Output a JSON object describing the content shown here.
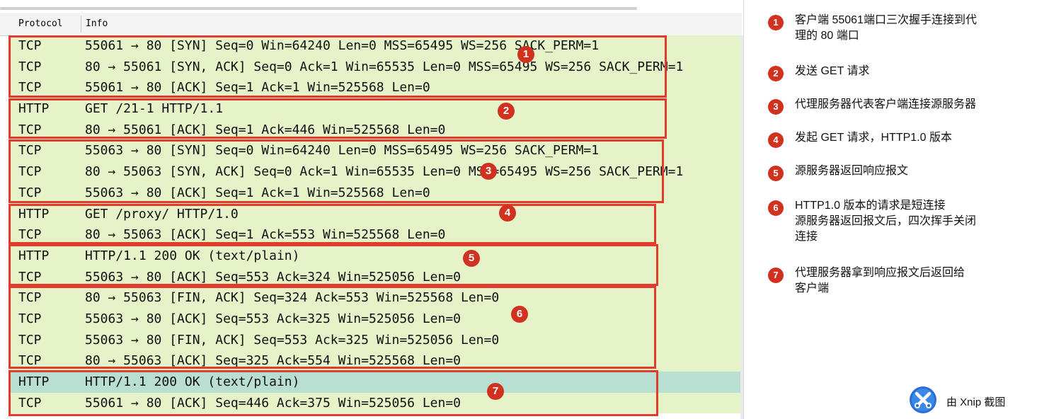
{
  "header": {
    "protocol": "Protocol",
    "info": "Info"
  },
  "rows": [
    {
      "protocol": "TCP",
      "info": "55061 → 80 [SYN] Seq=0 Win=64240 Len=0 MSS=65495 WS=256 SACK_PERM=1"
    },
    {
      "protocol": "TCP",
      "info": "80 → 55061 [SYN, ACK] Seq=0 Ack=1 Win=65535 Len=0 MSS=65495 WS=256 SACK_PERM=1"
    },
    {
      "protocol": "TCP",
      "info": "55061 → 80 [ACK] Seq=1 Ack=1 Win=525568 Len=0"
    },
    {
      "protocol": "HTTP",
      "info": "GET /21-1 HTTP/1.1"
    },
    {
      "protocol": "TCP",
      "info": "80 → 55061 [ACK] Seq=1 Ack=446 Win=525568 Len=0"
    },
    {
      "protocol": "TCP",
      "info": "55063 → 80 [SYN] Seq=0 Win=64240 Len=0 MSS=65495 WS=256 SACK_PERM=1"
    },
    {
      "protocol": "TCP",
      "info": "80 → 55063 [SYN, ACK] Seq=0 Ack=1 Win=65535 Len=0 MSS=65495 WS=256 SACK_PERM=1"
    },
    {
      "protocol": "TCP",
      "info": "55063 → 80 [ACK] Seq=1 Ack=1 Win=525568 Len=0"
    },
    {
      "protocol": "HTTP",
      "info": "GET /proxy/ HTTP/1.0"
    },
    {
      "protocol": "TCP",
      "info": "80 → 55063 [ACK] Seq=1 Ack=553 Win=525568 Len=0"
    },
    {
      "protocol": "HTTP",
      "info": "HTTP/1.1 200 OK  (text/plain)"
    },
    {
      "protocol": "TCP",
      "info": "55063 → 80 [ACK] Seq=553 Ack=324 Win=525056 Len=0"
    },
    {
      "protocol": "TCP",
      "info": "80 → 55063 [FIN, ACK] Seq=324 Ack=553 Win=525568 Len=0"
    },
    {
      "protocol": "TCP",
      "info": "55063 → 80 [ACK] Seq=553 Ack=325 Win=525056 Len=0"
    },
    {
      "protocol": "TCP",
      "info": "55063 → 80 [FIN, ACK] Seq=553 Ack=325 Win=525056 Len=0"
    },
    {
      "protocol": "TCP",
      "info": "80 → 55063 [ACK] Seq=325 Ack=554 Win=525568 Len=0"
    },
    {
      "protocol": "HTTP",
      "info": "HTTP/1.1 200 OK  (text/plain)"
    },
    {
      "protocol": "TCP",
      "info": "55061 → 80 [ACK] Seq=446 Ack=375 Win=525056 Len=0"
    }
  ],
  "groups": [
    "1",
    "2",
    "3",
    "4",
    "5",
    "6",
    "7"
  ],
  "notes": [
    {
      "num": "1",
      "text": "客户端 55061端口三次握手连接到代\n理的 80 端口"
    },
    {
      "num": "2",
      "text": "发送 GET 请求"
    },
    {
      "num": "3",
      "text": "代理服务器代表客户端连接源服务器"
    },
    {
      "num": "4",
      "text": "发起 GET 请求，HTTP1.0 版本"
    },
    {
      "num": "5",
      "text": "源服务器返回响应报文"
    },
    {
      "num": "6",
      "text": "HTTP1.0 版本的请求是短连接\n源服务器返回报文后，四次挥手关闭\n连接"
    },
    {
      "num": "7",
      "text": "代理服务器拿到响应报文后返回给\n客户端"
    }
  ],
  "watermark": {
    "label": "由 Xnip 截图",
    "icon": "xnip-logo-icon"
  },
  "colors": {
    "row_bg": "#e6f2c8",
    "row_selected": "#b9dfd2",
    "box": "#e23a2b",
    "badge": "#d0321f"
  }
}
